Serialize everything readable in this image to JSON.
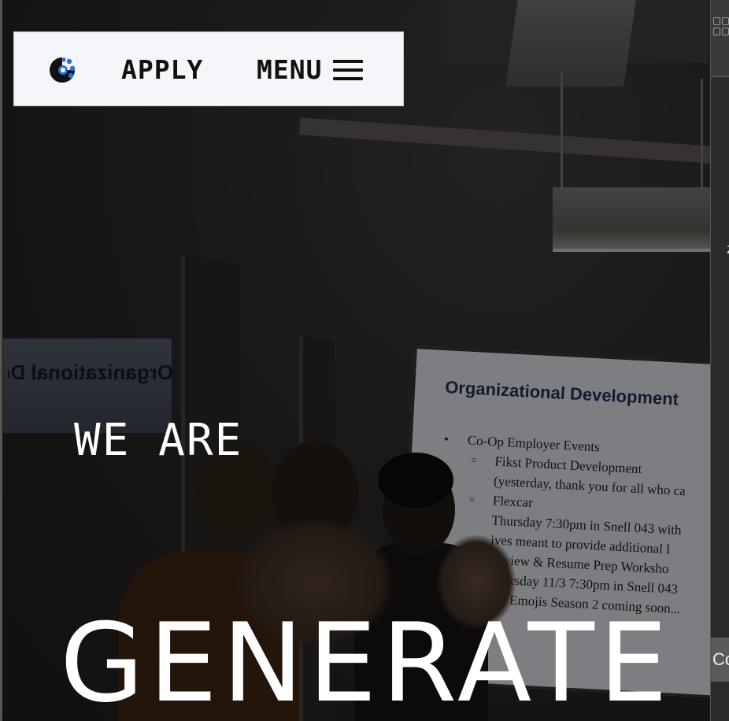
{
  "nav": {
    "logo_icon": "gear-like-circle-logo",
    "apply_label": "APPLY",
    "menu_label": "MENU",
    "menu_icon": "hamburger-icon"
  },
  "hero": {
    "line1": "WE ARE",
    "line2": "GENERATE",
    "background_photo": {
      "mirror_sign_text": "Organizational De",
      "slide_title": "Organizational Development",
      "slide_items": [
        {
          "level": 1,
          "text": "Co-Op Employer Events"
        },
        {
          "level": 2,
          "text": "Fikst Product Development"
        },
        {
          "level": 3,
          "text": "(yesterday, thank you for all who ca"
        },
        {
          "level": 2,
          "text": "Flexcar"
        },
        {
          "level": 3,
          "text": "Thursday 7:30pm in Snell 043 with"
        },
        {
          "level": 3,
          "text": "ives meant to provide additional l"
        },
        {
          "level": 3,
          "text": "terview & Resume Prep Worksho"
        },
        {
          "level": 3,
          "text": "Thursday 11/3 7:30pm in Snell 043"
        },
        {
          "level": 3,
          "text": "osh Emojis Season 2 coming soon..."
        }
      ]
    }
  },
  "side_panel": {
    "mark": "z",
    "chip_text": "Co"
  },
  "colors": {
    "nav_bg": "#f4f6f9",
    "logo_blue": "#2f6de1",
    "text_dark": "#111111",
    "hero_text": "#ffffff"
  }
}
